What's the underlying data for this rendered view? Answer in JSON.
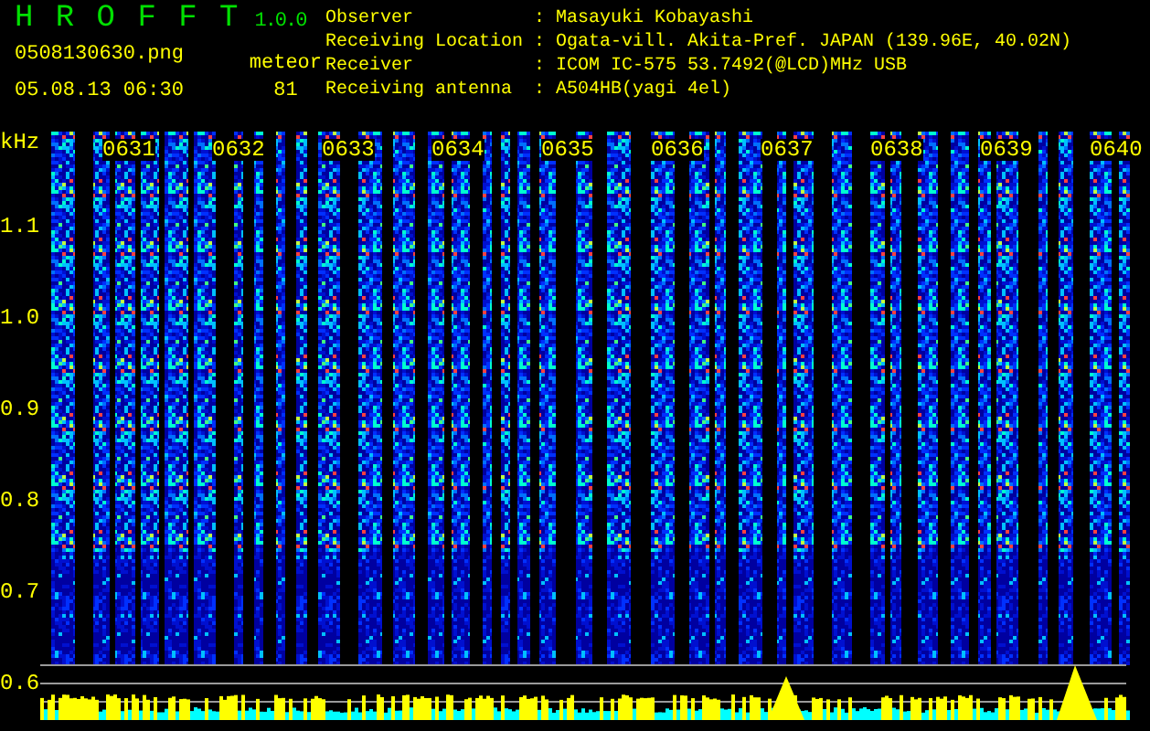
{
  "app": {
    "title": "H R O F F T",
    "version": "1.0.0",
    "file_name": "0508130630.png",
    "date_time": "05.08.13 06:30",
    "count_label": "meteor",
    "count": "81"
  },
  "info": [
    {
      "label": "Observer",
      "colon": ":",
      "value": "Masayuki Kobayashi"
    },
    {
      "label": "Receiving Location",
      "colon": ":",
      "value": "Ogata-vill. Akita-Pref. JAPAN (139.96E, 40.02N)"
    },
    {
      "label": "Receiver",
      "colon": ":",
      "value": "ICOM IC-575 53.7492(@LCD)MHz USB"
    },
    {
      "label": "Receiving antenna",
      "colon": ":",
      "value": "A504HB(yagi 4el)"
    }
  ],
  "y_axis": {
    "unit": "kHz",
    "ticks": [
      "1.1",
      "1.0",
      "0.9",
      "0.8",
      "0.7",
      "0.6"
    ]
  },
  "time_labels": [
    "0631",
    "0632",
    "0633",
    "0634",
    "0635",
    "0636",
    "0637",
    "0638",
    "0639",
    "0640"
  ]
}
